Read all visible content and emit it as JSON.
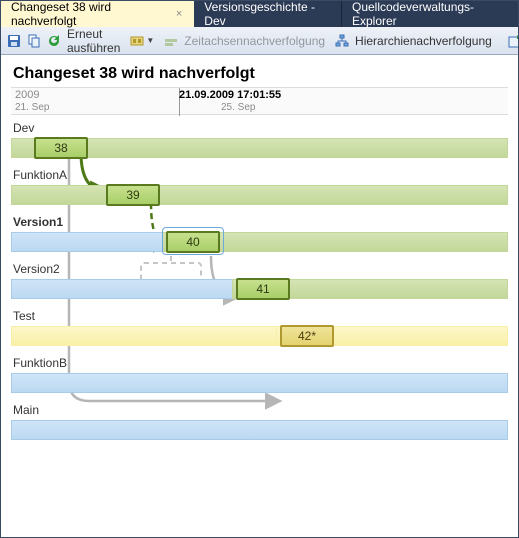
{
  "tabs": {
    "active": "Changeset 38 wird nachverfolgt",
    "second": "Versionsgeschichte - Dev",
    "third": "Quellcodeverwaltungs-Explorer"
  },
  "toolbar": {
    "rerun": "Erneut ausführen",
    "timeline": "Zeitachsennachverfolgung",
    "hierarchy": "Hierarchienachverfolgung"
  },
  "title": "Changeset 38 wird nachverfolgt",
  "timeline": {
    "year": "2009",
    "datestamp": "21.09.2009 17:01:55",
    "tick1": "21. Sep",
    "tick2": "25. Sep"
  },
  "branches": [
    {
      "name": "Dev",
      "cs": "38",
      "csLeft": 22,
      "bar": "green",
      "bold": false
    },
    {
      "name": "FunktionA",
      "cs": "39",
      "csLeft": 94,
      "bar": "green",
      "bold": false
    },
    {
      "name": "Version1",
      "cs": "40",
      "csLeft": 154,
      "bar": "green",
      "bold": true,
      "selected": true,
      "baseBar": "blue",
      "bar2Left": 150
    },
    {
      "name": "Version2",
      "cs": "41",
      "csLeft": 224,
      "bar": "green",
      "bold": false,
      "baseBar": "blue",
      "bar2Left": 220
    },
    {
      "name": "Test",
      "cs": "42*",
      "csLeft": 268,
      "bar": "yellow",
      "bold": false,
      "star": true,
      "bar2Left": 264
    },
    {
      "name": "FunktionB",
      "cs": null,
      "bar": "blue",
      "bold": false
    },
    {
      "name": "Main",
      "cs": null,
      "bar": "blue",
      "bold": false
    }
  ]
}
